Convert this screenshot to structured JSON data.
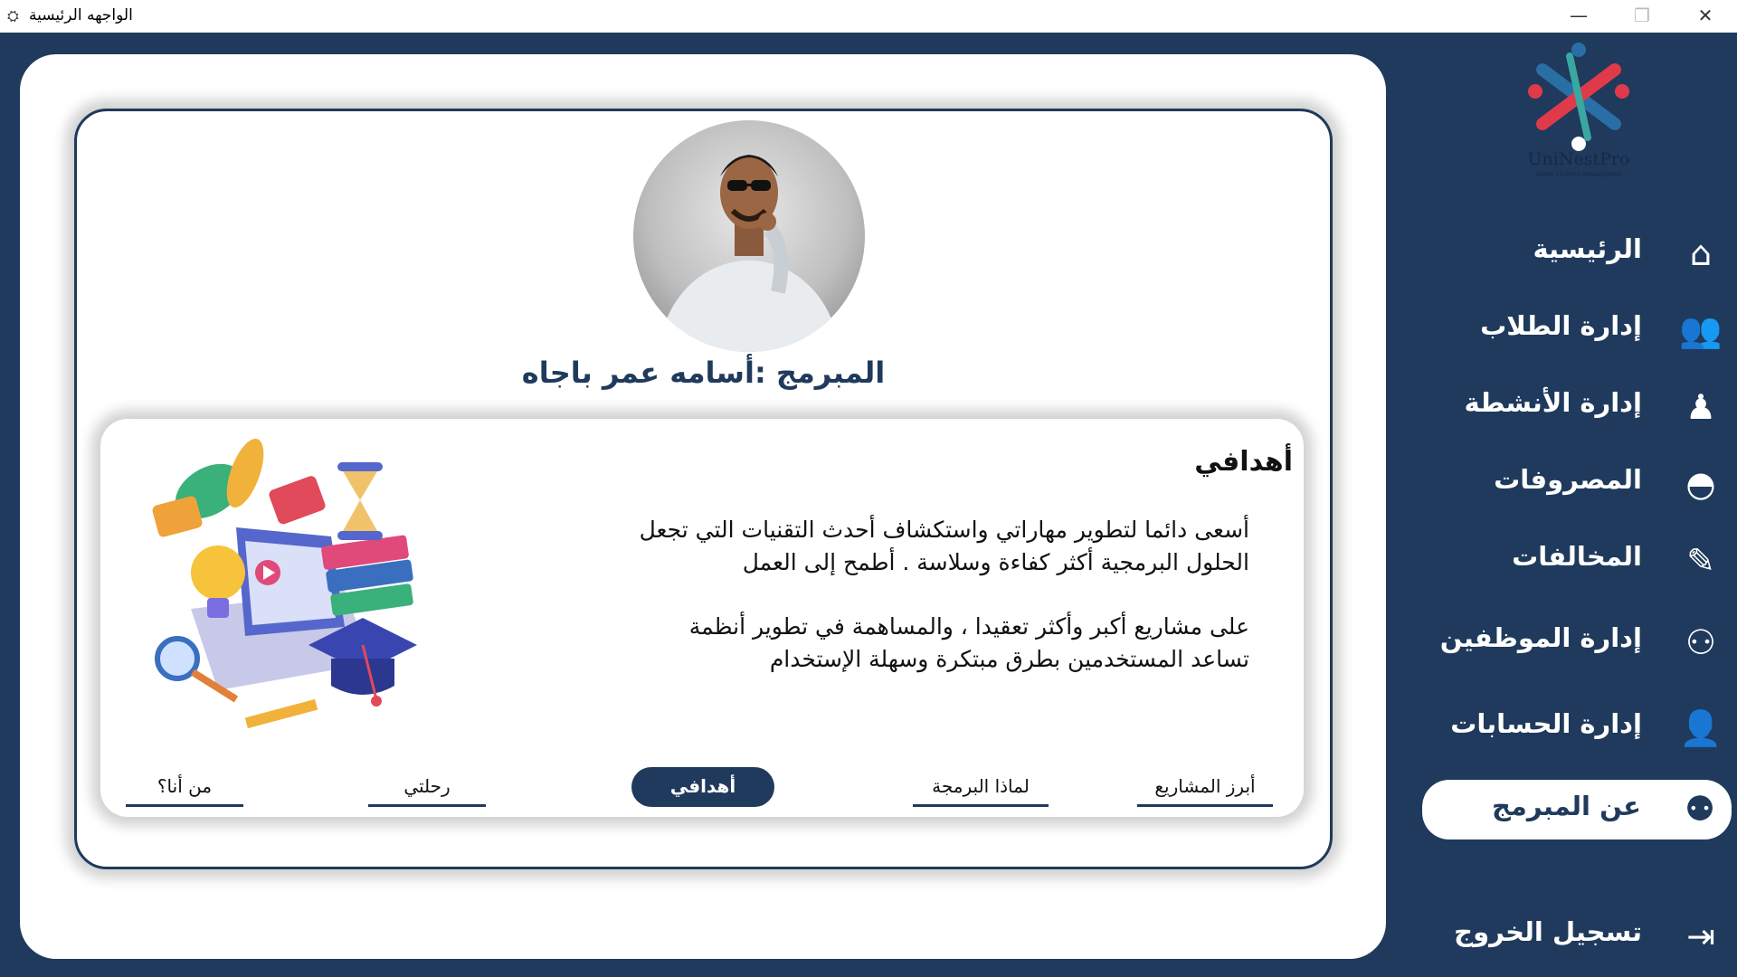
{
  "window": {
    "title": "الواجهه الرئيسية",
    "app_icon": "app-icon",
    "controls": [
      "minimize-icon",
      "maximize-icon",
      "close-icon"
    ]
  },
  "profile": {
    "name": "المبرمج :أسامه عمر باجاه",
    "goals_title": "أهدافي",
    "goals_paragraph1": "أسعى دائما لتطوير مهاراتي واستكشاف أحدث التقنيات التي تجعل الحلول البرمجية أكثر كفاءة وسلاسة . أطمح إلى العمل",
    "goals_paragraph2": "على مشاريع أكبر وأكثر تعقيدا ، والمساهمة في تطوير أنظمة تساعد المستخدمين بطرق مبتكرة وسهلة الإستخدام",
    "tabs": [
      "أبرز المشاريع",
      "لماذا البرمجة",
      "أهدافي",
      "رحلتي",
      "من أنا؟"
    ],
    "active_tab": "أهدافي"
  },
  "sidebar": {
    "logo_text": "UniNestPro",
    "logo_subtext": "SMART STUDENT MANAGEMENT",
    "items": [
      {
        "label": "الرئيسية",
        "icon": "home-icon"
      },
      {
        "label": "إدارة الطلاب",
        "icon": "users-icon"
      },
      {
        "label": "إدارة الأنشطة",
        "icon": "activity-icon"
      },
      {
        "label": "المصروفات",
        "icon": "dish-icon"
      },
      {
        "label": "المخالفات",
        "icon": "clipboard-icon"
      },
      {
        "label": "إدارة الموظفين",
        "icon": "team-icon"
      },
      {
        "label": "إدارة الحسابات",
        "icon": "user-card-icon"
      },
      {
        "label": "عن المبرمج",
        "icon": "developer-icon"
      },
      {
        "label": "تسجيل الخروج",
        "icon": "logout-icon"
      }
    ],
    "active_item": "عن المبرمج"
  },
  "colors": {
    "primary": "#1f3a5c",
    "background": "#ffffff",
    "logo_red": "#e03a4a",
    "logo_blue": "#2a6ea6",
    "logo_green": "#3aa8a0"
  }
}
